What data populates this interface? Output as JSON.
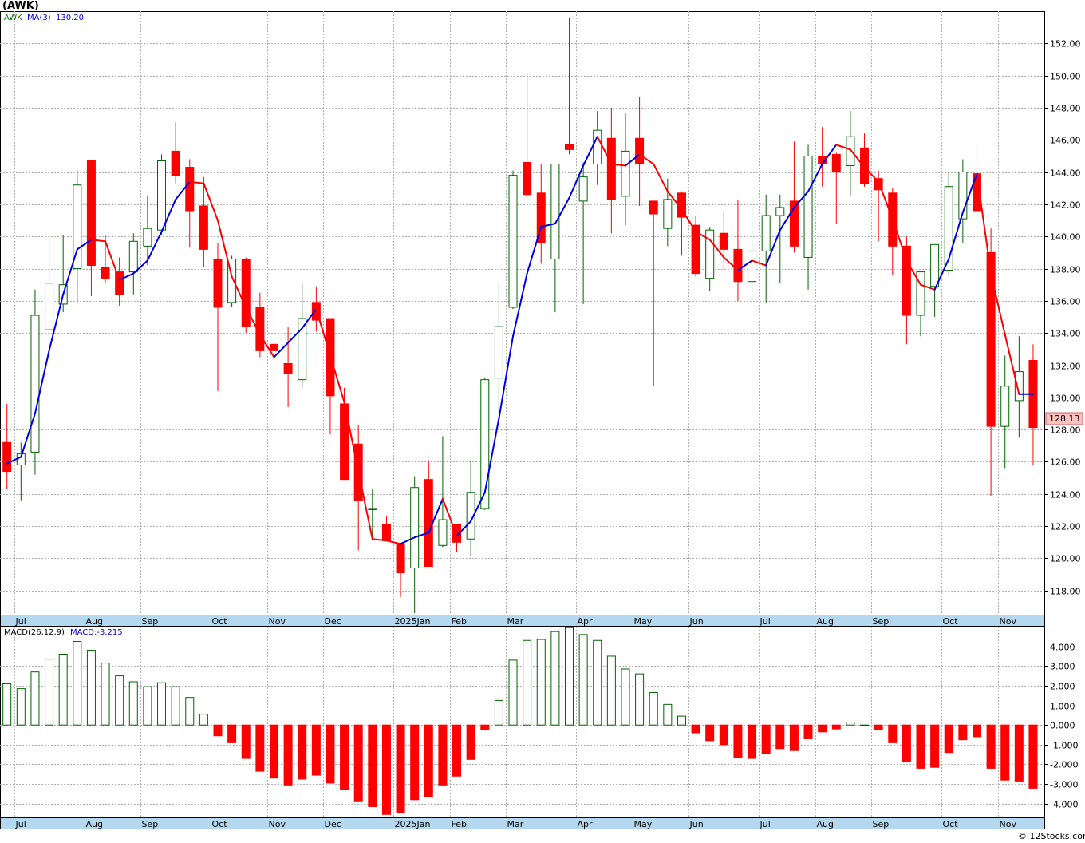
{
  "window": {
    "ticker_title": "(AWK)",
    "watermark": "© 12Stocks.com"
  },
  "price_panel": {
    "legend_symbol": "AWK",
    "legend_ma_label": "MA(3)",
    "legend_ma_value": "130.20",
    "last_price_label": "128.13",
    "colors": {
      "up_candle": "#006400",
      "down_candle": "#ff0000",
      "ma_up": "#0000dd",
      "ma_down": "#ff0000",
      "last_tag_bg": "#ffc0c0"
    }
  },
  "macd_panel": {
    "legend_label": "MACD(26,12,9)",
    "legend_value_label": "MACD:-3.215"
  },
  "chart_data": [
    {
      "type": "candlestick",
      "title": "(AWK)",
      "series_name": "AWK",
      "frequency": "weekly",
      "ylim": [
        116.5,
        154
      ],
      "yticks": [
        "118.00",
        "120.00",
        "122.00",
        "124.00",
        "126.00",
        "128.00",
        "130.00",
        "132.00",
        "134.00",
        "136.00",
        "138.00",
        "140.00",
        "142.00",
        "144.00",
        "146.00",
        "148.00",
        "150.00",
        "152.00"
      ],
      "x_month_labels": [
        {
          "label": "Jul",
          "week": 1
        },
        {
          "label": "Aug",
          "week": 6
        },
        {
          "label": "Sep",
          "week": 10
        },
        {
          "label": "Oct",
          "week": 15
        },
        {
          "label": "Nov",
          "week": 19
        },
        {
          "label": "Dec",
          "week": 23
        },
        {
          "label": "2025Jan",
          "week": 28
        },
        {
          "label": "Feb",
          "week": 32
        },
        {
          "label": "Mar",
          "week": 36
        },
        {
          "label": "Apr",
          "week": 41
        },
        {
          "label": "May",
          "week": 45
        },
        {
          "label": "Jun",
          "week": 49
        },
        {
          "label": "Jul",
          "week": 54
        },
        {
          "label": "Aug",
          "week": 58
        },
        {
          "label": "Sep",
          "week": 62
        },
        {
          "label": "Oct",
          "week": 67
        },
        {
          "label": "Nov",
          "week": 71
        }
      ],
      "ohlc": [
        [
          127.2,
          129.6,
          124.3,
          125.4
        ],
        [
          125.8,
          127.2,
          123.6,
          126.5
        ],
        [
          126.6,
          136.7,
          125.2,
          135.1
        ],
        [
          134.2,
          140.0,
          132.3,
          137.1
        ],
        [
          135.8,
          140.1,
          135.3,
          137.0
        ],
        [
          138.0,
          144.1,
          135.9,
          143.2
        ],
        [
          144.7,
          144.7,
          136.3,
          138.2
        ],
        [
          138.1,
          140.1,
          137.1,
          137.4
        ],
        [
          137.8,
          138.7,
          135.7,
          136.4
        ],
        [
          137.8,
          140.2,
          136.4,
          139.7
        ],
        [
          139.4,
          142.5,
          138.2,
          140.5
        ],
        [
          140.4,
          145.1,
          140.1,
          144.7
        ],
        [
          145.3,
          147.1,
          143.3,
          143.8
        ],
        [
          144.3,
          144.8,
          139.3,
          141.6
        ],
        [
          141.9,
          143.7,
          138.1,
          139.2
        ],
        [
          138.6,
          139.6,
          130.4,
          135.6
        ],
        [
          135.9,
          138.8,
          135.6,
          138.6
        ],
        [
          138.6,
          138.7,
          134.0,
          134.4
        ],
        [
          135.6,
          136.5,
          132.5,
          132.9
        ],
        [
          133.3,
          136.2,
          128.4,
          132.9
        ],
        [
          132.1,
          134.4,
          129.4,
          131.5
        ],
        [
          131.1,
          137.1,
          130.6,
          134.9
        ],
        [
          135.9,
          136.9,
          134.1,
          134.8
        ],
        [
          134.9,
          134.9,
          127.7,
          130.1
        ],
        [
          129.6,
          130.6,
          126.1,
          124.9
        ],
        [
          127.1,
          128.3,
          120.5,
          123.6
        ],
        [
          123.1,
          124.3,
          121.1,
          123.1
        ],
        [
          122.1,
          122.6,
          121.5,
          121.1
        ],
        [
          120.9,
          120.9,
          117.6,
          119.1
        ],
        [
          119.4,
          125.1,
          116.6,
          124.4
        ],
        [
          124.9,
          126.1,
          119.5,
          119.5
        ],
        [
          120.8,
          127.6,
          120.7,
          122.4
        ],
        [
          122.1,
          122.1,
          120.4,
          121.0
        ],
        [
          121.2,
          126.1,
          120.1,
          124.1
        ],
        [
          123.1,
          131.2,
          123.0,
          131.1
        ],
        [
          131.2,
          137.1,
          128.9,
          134.4
        ],
        [
          135.6,
          144.1,
          135.5,
          143.8
        ],
        [
          144.6,
          150.1,
          142.4,
          142.6
        ],
        [
          142.7,
          144.5,
          138.3,
          139.6
        ],
        [
          138.6,
          144.2,
          135.3,
          144.5
        ],
        [
          145.7,
          153.6,
          145.1,
          145.4
        ],
        [
          142.2,
          144.6,
          135.8,
          143.7
        ],
        [
          144.5,
          147.8,
          143.2,
          146.6
        ],
        [
          146.1,
          148.0,
          140.2,
          142.3
        ],
        [
          142.5,
          147.7,
          140.7,
          145.3
        ],
        [
          146.1,
          148.7,
          141.9,
          144.5
        ],
        [
          142.2,
          142.2,
          130.7,
          141.4
        ],
        [
          140.5,
          143.6,
          139.4,
          142.3
        ],
        [
          142.7,
          142.8,
          138.8,
          141.2
        ],
        [
          140.7,
          141.3,
          137.5,
          137.7
        ],
        [
          137.4,
          140.6,
          136.6,
          140.4
        ],
        [
          140.2,
          141.6,
          138.0,
          139.2
        ],
        [
          139.2,
          142.3,
          136.0,
          137.2
        ],
        [
          137.2,
          142.4,
          136.5,
          139.1
        ],
        [
          139.1,
          142.6,
          135.9,
          141.3
        ],
        [
          141.3,
          142.6,
          137.1,
          141.8
        ],
        [
          142.2,
          145.9,
          139.0,
          139.4
        ],
        [
          138.7,
          145.7,
          136.7,
          145.0
        ],
        [
          145.0,
          146.8,
          143.1,
          144.5
        ],
        [
          145.1,
          145.2,
          140.8,
          144.0
        ],
        [
          144.4,
          147.8,
          142.5,
          146.2
        ],
        [
          145.5,
          146.4,
          143.1,
          143.3
        ],
        [
          143.6,
          144.1,
          139.7,
          142.9
        ],
        [
          142.7,
          143.0,
          137.6,
          139.4
        ],
        [
          139.4,
          140.0,
          133.3,
          135.1
        ],
        [
          135.1,
          137.6,
          133.8,
          137.8
        ],
        [
          136.9,
          138.1,
          135.0,
          139.5
        ],
        [
          137.9,
          144.0,
          137.6,
          143.1
        ],
        [
          141.1,
          144.8,
          139.6,
          144.0
        ],
        [
          143.9,
          145.6,
          141.4,
          141.6
        ],
        [
          139.0,
          140.5,
          123.9,
          128.2
        ],
        [
          128.2,
          132.6,
          125.6,
          130.7
        ],
        [
          129.8,
          133.8,
          127.5,
          131.6
        ],
        [
          132.3,
          133.3,
          125.8,
          128.13
        ]
      ],
      "ma3": [
        125.9,
        126.3,
        129.0,
        132.9,
        136.4,
        139.2,
        139.8,
        139.7,
        137.3,
        137.7,
        138.5,
        140.3,
        142.3,
        143.4,
        143.3,
        141.0,
        137.5,
        135.6,
        133.9,
        132.5,
        133.4,
        134.3,
        135.5,
        132.6,
        129.7,
        125.4,
        121.2,
        121.1,
        120.9,
        121.3,
        121.6,
        123.7,
        121.4,
        122.3,
        124.1,
        128.7,
        133.8,
        137.7,
        140.6,
        140.8,
        142.4,
        144.4,
        146.2,
        144.5,
        144.4,
        145.1,
        144.5,
        142.8,
        141.7,
        140.3,
        139.8,
        138.7,
        137.9,
        138.5,
        138.2,
        140.4,
        141.8,
        142.8,
        144.5,
        145.7,
        145.4,
        144.3,
        143.4,
        141.1,
        138.5,
        137.0,
        136.7,
        138.6,
        141.5,
        143.9,
        137.7,
        133.9,
        130.2,
        130.2
      ]
    },
    {
      "type": "bar",
      "title": "MACD(26,12,9)",
      "series_name": "MACD",
      "ylim": [
        -4.7,
        5.0
      ],
      "yticks": [
        "-4.000",
        "-3.000",
        "-2.000",
        "-1.000",
        "0.000",
        "1.000",
        "2.000",
        "3.000",
        "4.000"
      ],
      "values": [
        2.1,
        1.85,
        2.7,
        3.35,
        3.6,
        4.25,
        3.8,
        3.15,
        2.5,
        2.2,
        1.95,
        2.15,
        1.95,
        1.4,
        0.55,
        -0.55,
        -0.9,
        -1.7,
        -2.35,
        -2.7,
        -3.05,
        -2.75,
        -2.55,
        -2.95,
        -3.3,
        -3.9,
        -4.15,
        -4.55,
        -4.45,
        -3.8,
        -3.65,
        -3.05,
        -2.6,
        -1.75,
        -0.25,
        1.25,
        3.3,
        4.3,
        4.35,
        4.75,
        4.95,
        4.6,
        4.3,
        3.5,
        2.85,
        2.6,
        1.65,
        1.05,
        0.45,
        -0.4,
        -0.8,
        -1.0,
        -1.65,
        -1.7,
        -1.45,
        -1.2,
        -1.3,
        -0.7,
        -0.35,
        -0.2,
        0.15,
        0.0,
        -0.25,
        -0.9,
        -1.85,
        -2.2,
        -2.15,
        -1.4,
        -0.75,
        -0.6,
        -2.2,
        -2.8,
        -2.85,
        -3.215
      ]
    }
  ]
}
